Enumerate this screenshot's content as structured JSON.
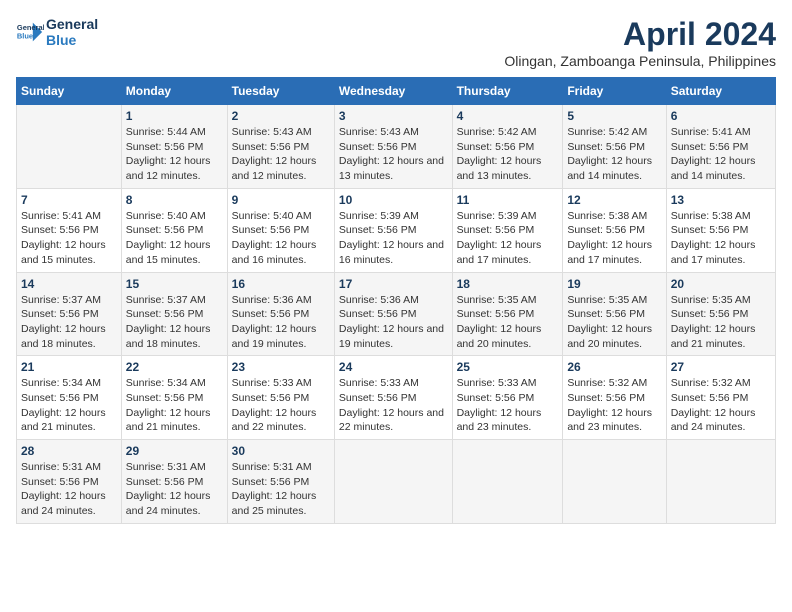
{
  "logo": {
    "line1": "General",
    "line2": "Blue"
  },
  "title": "April 2024",
  "subtitle": "Olingan, Zamboanga Peninsula, Philippines",
  "days_header": [
    "Sunday",
    "Monday",
    "Tuesday",
    "Wednesday",
    "Thursday",
    "Friday",
    "Saturday"
  ],
  "weeks": [
    [
      {
        "num": "",
        "sunrise": "",
        "sunset": "",
        "daylight": ""
      },
      {
        "num": "1",
        "sunrise": "Sunrise: 5:44 AM",
        "sunset": "Sunset: 5:56 PM",
        "daylight": "Daylight: 12 hours and 12 minutes."
      },
      {
        "num": "2",
        "sunrise": "Sunrise: 5:43 AM",
        "sunset": "Sunset: 5:56 PM",
        "daylight": "Daylight: 12 hours and 12 minutes."
      },
      {
        "num": "3",
        "sunrise": "Sunrise: 5:43 AM",
        "sunset": "Sunset: 5:56 PM",
        "daylight": "Daylight: 12 hours and 13 minutes."
      },
      {
        "num": "4",
        "sunrise": "Sunrise: 5:42 AM",
        "sunset": "Sunset: 5:56 PM",
        "daylight": "Daylight: 12 hours and 13 minutes."
      },
      {
        "num": "5",
        "sunrise": "Sunrise: 5:42 AM",
        "sunset": "Sunset: 5:56 PM",
        "daylight": "Daylight: 12 hours and 14 minutes."
      },
      {
        "num": "6",
        "sunrise": "Sunrise: 5:41 AM",
        "sunset": "Sunset: 5:56 PM",
        "daylight": "Daylight: 12 hours and 14 minutes."
      }
    ],
    [
      {
        "num": "7",
        "sunrise": "Sunrise: 5:41 AM",
        "sunset": "Sunset: 5:56 PM",
        "daylight": "Daylight: 12 hours and 15 minutes."
      },
      {
        "num": "8",
        "sunrise": "Sunrise: 5:40 AM",
        "sunset": "Sunset: 5:56 PM",
        "daylight": "Daylight: 12 hours and 15 minutes."
      },
      {
        "num": "9",
        "sunrise": "Sunrise: 5:40 AM",
        "sunset": "Sunset: 5:56 PM",
        "daylight": "Daylight: 12 hours and 16 minutes."
      },
      {
        "num": "10",
        "sunrise": "Sunrise: 5:39 AM",
        "sunset": "Sunset: 5:56 PM",
        "daylight": "Daylight: 12 hours and 16 minutes."
      },
      {
        "num": "11",
        "sunrise": "Sunrise: 5:39 AM",
        "sunset": "Sunset: 5:56 PM",
        "daylight": "Daylight: 12 hours and 17 minutes."
      },
      {
        "num": "12",
        "sunrise": "Sunrise: 5:38 AM",
        "sunset": "Sunset: 5:56 PM",
        "daylight": "Daylight: 12 hours and 17 minutes."
      },
      {
        "num": "13",
        "sunrise": "Sunrise: 5:38 AM",
        "sunset": "Sunset: 5:56 PM",
        "daylight": "Daylight: 12 hours and 17 minutes."
      }
    ],
    [
      {
        "num": "14",
        "sunrise": "Sunrise: 5:37 AM",
        "sunset": "Sunset: 5:56 PM",
        "daylight": "Daylight: 12 hours and 18 minutes."
      },
      {
        "num": "15",
        "sunrise": "Sunrise: 5:37 AM",
        "sunset": "Sunset: 5:56 PM",
        "daylight": "Daylight: 12 hours and 18 minutes."
      },
      {
        "num": "16",
        "sunrise": "Sunrise: 5:36 AM",
        "sunset": "Sunset: 5:56 PM",
        "daylight": "Daylight: 12 hours and 19 minutes."
      },
      {
        "num": "17",
        "sunrise": "Sunrise: 5:36 AM",
        "sunset": "Sunset: 5:56 PM",
        "daylight": "Daylight: 12 hours and 19 minutes."
      },
      {
        "num": "18",
        "sunrise": "Sunrise: 5:35 AM",
        "sunset": "Sunset: 5:56 PM",
        "daylight": "Daylight: 12 hours and 20 minutes."
      },
      {
        "num": "19",
        "sunrise": "Sunrise: 5:35 AM",
        "sunset": "Sunset: 5:56 PM",
        "daylight": "Daylight: 12 hours and 20 minutes."
      },
      {
        "num": "20",
        "sunrise": "Sunrise: 5:35 AM",
        "sunset": "Sunset: 5:56 PM",
        "daylight": "Daylight: 12 hours and 21 minutes."
      }
    ],
    [
      {
        "num": "21",
        "sunrise": "Sunrise: 5:34 AM",
        "sunset": "Sunset: 5:56 PM",
        "daylight": "Daylight: 12 hours and 21 minutes."
      },
      {
        "num": "22",
        "sunrise": "Sunrise: 5:34 AM",
        "sunset": "Sunset: 5:56 PM",
        "daylight": "Daylight: 12 hours and 21 minutes."
      },
      {
        "num": "23",
        "sunrise": "Sunrise: 5:33 AM",
        "sunset": "Sunset: 5:56 PM",
        "daylight": "Daylight: 12 hours and 22 minutes."
      },
      {
        "num": "24",
        "sunrise": "Sunrise: 5:33 AM",
        "sunset": "Sunset: 5:56 PM",
        "daylight": "Daylight: 12 hours and 22 minutes."
      },
      {
        "num": "25",
        "sunrise": "Sunrise: 5:33 AM",
        "sunset": "Sunset: 5:56 PM",
        "daylight": "Daylight: 12 hours and 23 minutes."
      },
      {
        "num": "26",
        "sunrise": "Sunrise: 5:32 AM",
        "sunset": "Sunset: 5:56 PM",
        "daylight": "Daylight: 12 hours and 23 minutes."
      },
      {
        "num": "27",
        "sunrise": "Sunrise: 5:32 AM",
        "sunset": "Sunset: 5:56 PM",
        "daylight": "Daylight: 12 hours and 24 minutes."
      }
    ],
    [
      {
        "num": "28",
        "sunrise": "Sunrise: 5:31 AM",
        "sunset": "Sunset: 5:56 PM",
        "daylight": "Daylight: 12 hours and 24 minutes."
      },
      {
        "num": "29",
        "sunrise": "Sunrise: 5:31 AM",
        "sunset": "Sunset: 5:56 PM",
        "daylight": "Daylight: 12 hours and 24 minutes."
      },
      {
        "num": "30",
        "sunrise": "Sunrise: 5:31 AM",
        "sunset": "Sunset: 5:56 PM",
        "daylight": "Daylight: 12 hours and 25 minutes."
      },
      {
        "num": "",
        "sunrise": "",
        "sunset": "",
        "daylight": ""
      },
      {
        "num": "",
        "sunrise": "",
        "sunset": "",
        "daylight": ""
      },
      {
        "num": "",
        "sunrise": "",
        "sunset": "",
        "daylight": ""
      },
      {
        "num": "",
        "sunrise": "",
        "sunset": "",
        "daylight": ""
      }
    ]
  ]
}
